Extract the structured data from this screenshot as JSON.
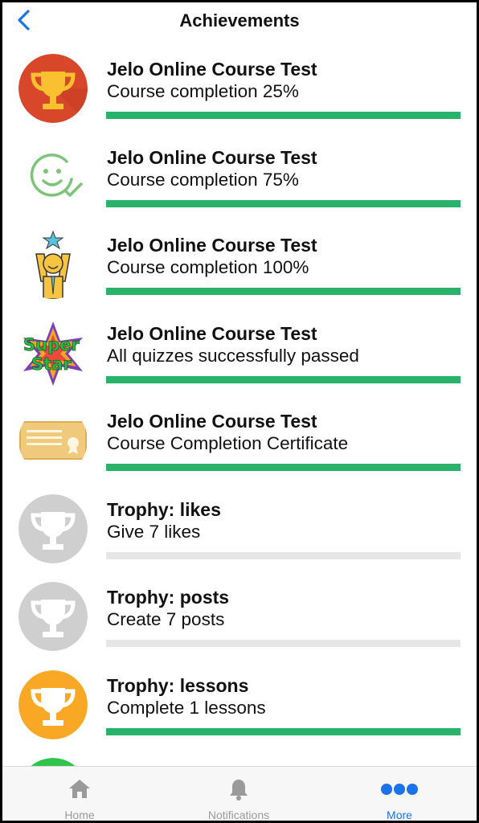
{
  "header": {
    "title": "Achievements"
  },
  "achievements": [
    {
      "title": "Jelo Online Course Test",
      "subtitle": "Course completion 25%",
      "progress": 1.0,
      "icon": "trophy-icon",
      "icon_color": "#d9472b"
    },
    {
      "title": "Jelo Online Course Test",
      "subtitle": "Course completion 75%",
      "progress": 1.0,
      "icon": "smiley-check-icon",
      "icon_color": "#7dc47a"
    },
    {
      "title": "Jelo Online Course Test",
      "subtitle": "Course completion 100%",
      "progress": 1.0,
      "icon": "star-person-icon",
      "icon_color": "#f5c542"
    },
    {
      "title": "Jelo Online Course Test",
      "subtitle": "All quizzes successfully passed",
      "progress": 1.0,
      "icon": "superstar-icon",
      "icon_color": "#2db84b"
    },
    {
      "title": "Jelo Online Course Test",
      "subtitle": "Course Completion Certificate",
      "progress": 1.0,
      "icon": "certificate-icon",
      "icon_color": "#f0c97a"
    },
    {
      "title": "Trophy: likes",
      "subtitle": "Give 7 likes",
      "progress": 0.0,
      "icon": "trophy-icon",
      "icon_color": "#cfcfcf"
    },
    {
      "title": "Trophy: posts",
      "subtitle": "Create 7 posts",
      "progress": 0.0,
      "icon": "trophy-icon",
      "icon_color": "#cfcfcf"
    },
    {
      "title": "Trophy: lessons",
      "subtitle": "Complete 1 lessons",
      "progress": 1.0,
      "icon": "trophy-icon",
      "icon_color": "#f9a825"
    }
  ],
  "tabbar": {
    "home": "Home",
    "notifications": "Notifications",
    "more": "More",
    "active": "more"
  },
  "colors": {
    "accent": "#1a73e8",
    "progress": "#29b36a",
    "track": "#e6e6e6"
  }
}
